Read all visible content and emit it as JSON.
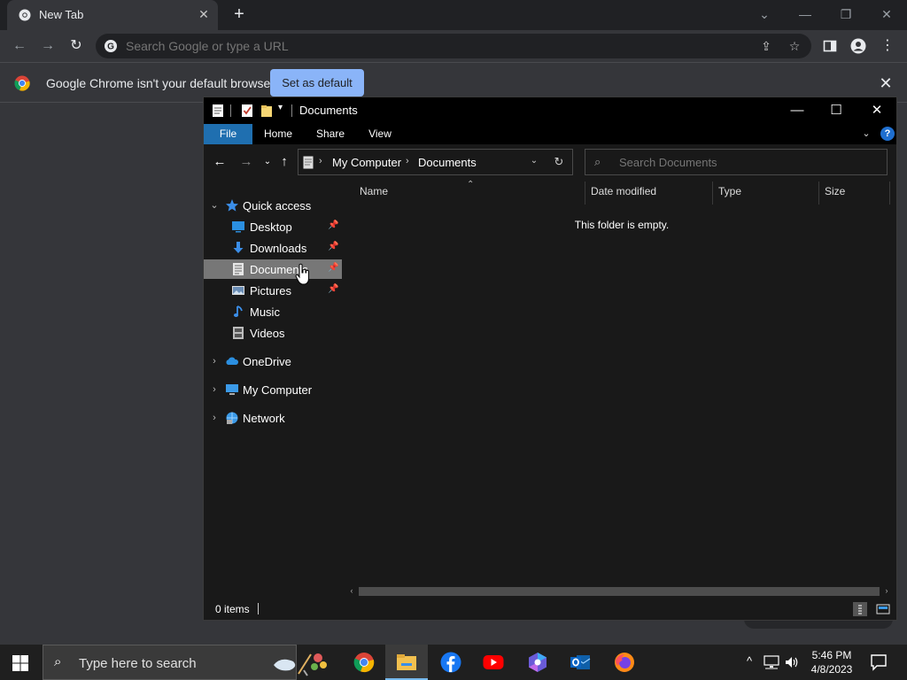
{
  "chrome": {
    "tab_title": "New Tab",
    "omnibox_placeholder": "Search Google or type a URL",
    "infobar_message": "Google Chrome isn't your default browser",
    "set_default_label": "Set as default"
  },
  "explorer": {
    "title": "Documents",
    "ribbon_tabs": [
      "File",
      "Home",
      "Share",
      "View"
    ],
    "breadcrumb": [
      "My Computer",
      "Documents"
    ],
    "search_placeholder": "Search Documents",
    "tree": {
      "quick_access": "Quick access",
      "desktop": "Desktop",
      "downloads": "Downloads",
      "documents": "Documents",
      "pictures": "Pictures",
      "music": "Music",
      "videos": "Videos",
      "onedrive": "OneDrive",
      "my_computer": "My Computer",
      "network": "Network"
    },
    "columns": [
      "Name",
      "Date modified",
      "Type",
      "Size"
    ],
    "empty_message": "This folder is empty.",
    "status_count": "0 items"
  },
  "taskbar": {
    "search_text": "Type here to search",
    "time": "5:46 PM",
    "date": "4/8/2023"
  },
  "colors": {
    "accent_blue": "#8ab4f8",
    "selection_gray": "#777777",
    "file_tab_blue": "#1f6fb0"
  }
}
